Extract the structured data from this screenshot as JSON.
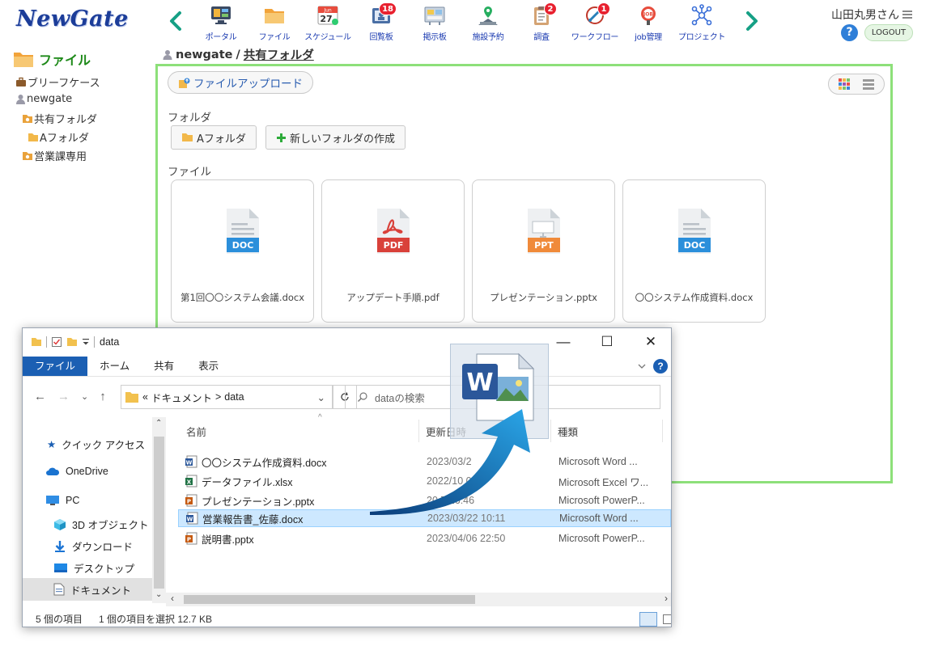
{
  "header": {
    "logo": "NewGate",
    "nav": [
      {
        "label": "ポータル",
        "icon": "portal-icon",
        "badge": ""
      },
      {
        "label": "ファイル",
        "icon": "file-folder-icon",
        "badge": ""
      },
      {
        "label": "スケジュール",
        "icon": "calendar-icon",
        "badge": ""
      },
      {
        "label": "回覧板",
        "icon": "circular-board-icon",
        "badge": "18"
      },
      {
        "label": "掲示板",
        "icon": "bulletin-board-icon",
        "badge": ""
      },
      {
        "label": "施設予約",
        "icon": "facility-icon",
        "badge": ""
      },
      {
        "label": "調査",
        "icon": "survey-icon",
        "badge": "2"
      },
      {
        "label": "ワークフロー",
        "icon": "workflow-icon",
        "badge": "1"
      },
      {
        "label": "job管理",
        "icon": "job-icon",
        "badge": ""
      },
      {
        "label": "プロジェクト",
        "icon": "project-icon",
        "badge": ""
      }
    ],
    "calendar_month": "Jun",
    "calendar_day": "27",
    "job_tag": "JOB",
    "user_name": "山田丸男さん",
    "help": "?",
    "logout": "LOGOUT"
  },
  "tree": {
    "title": "ファイル",
    "items": [
      {
        "label": "ブリーフケース",
        "icon": "briefcase-icon"
      },
      {
        "label": "newgate",
        "icon": "user-icon"
      },
      {
        "label": "共有フォルダ",
        "icon": "shared-folder-icon"
      },
      {
        "label": "Aフォルダ",
        "icon": "folder-icon"
      },
      {
        "label": "営業課専用",
        "icon": "shared-folder-icon"
      }
    ]
  },
  "breadcrumb": {
    "root": "newgate",
    "separator": "/",
    "current": "共有フォルダ"
  },
  "panel": {
    "upload_label": "ファイルアップロード",
    "folders_label": "フォルダ",
    "folder_button": "Aフォルダ",
    "new_folder_button": "新しいフォルダの作成",
    "files_label": "ファイル",
    "files": [
      {
        "name": "第1回〇〇システム会議.docx",
        "type": "DOC",
        "color": "#2b8fdb"
      },
      {
        "name": "アップデート手順.pdf",
        "type": "PDF",
        "color": "#d9413a"
      },
      {
        "name": "プレゼンテーション.pptx",
        "type": "PPT",
        "color": "#f08a3a"
      },
      {
        "name": "〇〇システム作成資料.docx",
        "type": "DOC",
        "color": "#2b8fdb"
      }
    ]
  },
  "explorer": {
    "title": "data",
    "controls": {
      "minimize": "—",
      "maximize": "☐",
      "close": "✕"
    },
    "ribbon_tabs": [
      "ファイル",
      "ホーム",
      "共有",
      "表示"
    ],
    "address": {
      "prefix": "«",
      "parts": [
        "ドキュメント",
        "data"
      ],
      "separator": ">"
    },
    "search_placeholder": "dataの検索",
    "nav": [
      {
        "label": "クイック アクセス",
        "icon": "star-icon"
      },
      {
        "label": "OneDrive",
        "icon": "cloud-icon"
      },
      {
        "label": "PC",
        "icon": "pc-icon"
      },
      {
        "label": "3D オブジェクト",
        "icon": "cube-icon"
      },
      {
        "label": "ダウンロード",
        "icon": "download-icon"
      },
      {
        "label": "デスクトップ",
        "icon": "desktop-icon"
      },
      {
        "label": "ドキュメント",
        "icon": "documents-icon"
      }
    ],
    "columns": [
      "名前",
      "更新日時",
      "種類"
    ],
    "files": [
      {
        "name": "〇〇システム作成資料.docx",
        "date": "2023/03/2",
        "type": "Microsoft Word ...",
        "app": "W",
        "color": "#2b579a"
      },
      {
        "name": "データファイル.xlsx",
        "date": "2022/10 08",
        "type": "Microsoft Excel ワ...",
        "app": "X",
        "color": "#217346"
      },
      {
        "name": "プレゼンテーション.pptx",
        "date": "20 7 16:46",
        "type": "Microsoft PowerP...",
        "app": "P",
        "color": "#c55a11"
      },
      {
        "name": "営業報告書_佐藤.docx",
        "date": "2023/03/22 10:11",
        "type": "Microsoft Word ...",
        "app": "W",
        "color": "#2b579a"
      },
      {
        "name": "説明書.pptx",
        "date": "2023/04/06 22:50",
        "type": "Microsoft PowerP...",
        "app": "P",
        "color": "#c55a11"
      }
    ],
    "selected_index": 3,
    "status_items": "5 個の項目",
    "status_selected": "1 個の項目を選択 12.7 KB"
  },
  "drag": {
    "icon": "word-document-icon",
    "letter": "W"
  },
  "colors": {
    "brand": "#1c3d99",
    "panel_border": "#8de07a",
    "nav_text": "#1a3ab0",
    "badge": "#e8212f",
    "tree_title": "#1f8a1a",
    "explorer_tab": "#1b5fb3",
    "selection": "#cde8ff"
  }
}
